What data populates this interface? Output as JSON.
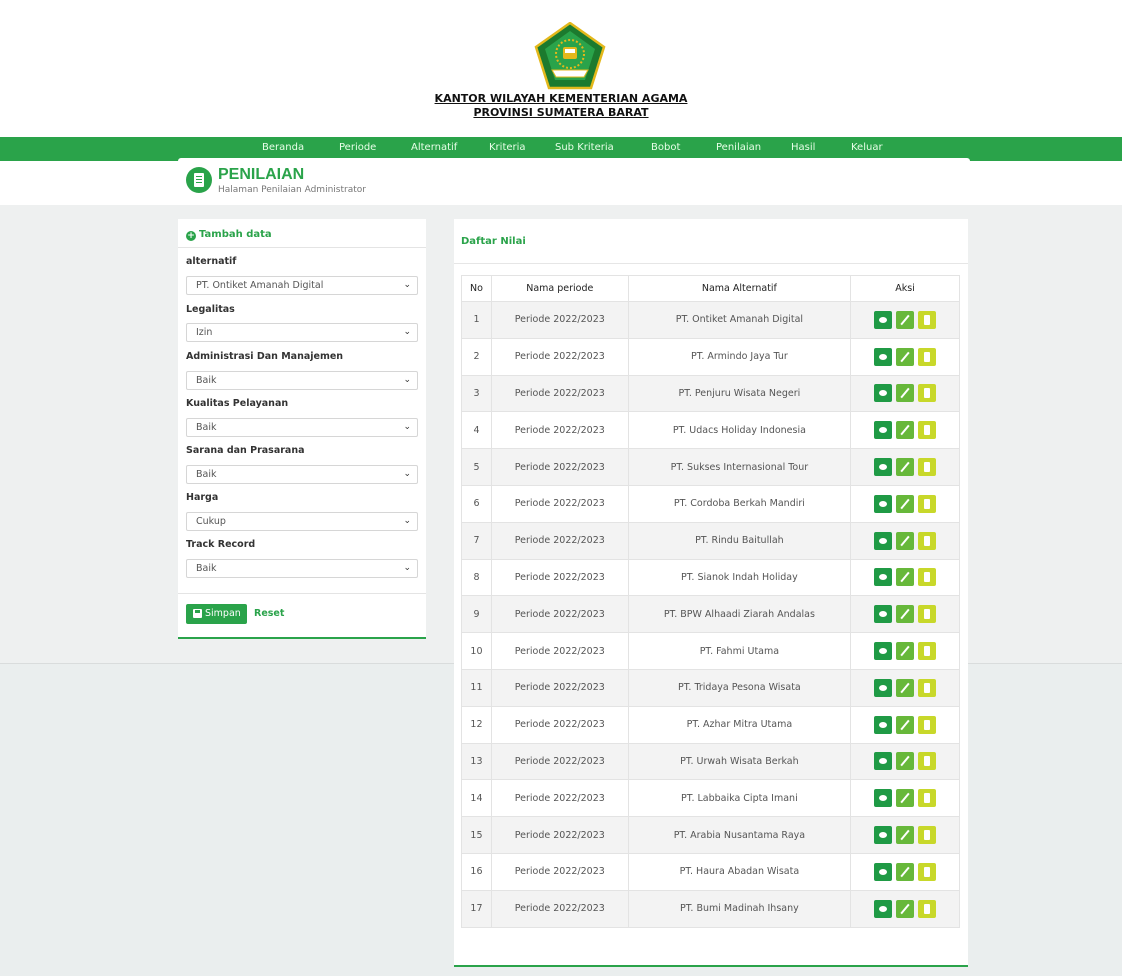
{
  "header": {
    "org_line1": "KANTOR WILAYAH KEMENTERIAN AGAMA",
    "org_line2": "PROVINSI SUMATERA BARAT"
  },
  "nav": {
    "items": [
      "Beranda",
      "Periode",
      "Alternatif",
      "Kriteria",
      "Sub Kriteria",
      "Bobot",
      "Penilaian",
      "Hasil",
      "Keluar"
    ]
  },
  "page": {
    "title": "PENILAIAN",
    "subtitle": "Halaman Penilaian Administrator"
  },
  "form": {
    "add_label": "Tambah data",
    "fields": [
      {
        "label": "alternatif",
        "value": "PT. Ontiket Amanah Digital"
      },
      {
        "label": "Legalitas",
        "value": "Izin"
      },
      {
        "label": "Administrasi Dan Manajemen",
        "value": "Baik"
      },
      {
        "label": "Kualitas Pelayanan",
        "value": "Baik"
      },
      {
        "label": "Sarana dan Prasarana",
        "value": "Baik"
      },
      {
        "label": "Harga",
        "value": "Cukup"
      },
      {
        "label": "Track Record",
        "value": "Baik"
      }
    ],
    "save_label": "Simpan",
    "reset_label": "Reset"
  },
  "table": {
    "title": "Daftar Nilai",
    "columns": [
      "No",
      "Nama periode",
      "Nama Alternatif",
      "Aksi"
    ],
    "rows": [
      {
        "no": "1",
        "periode": "Periode 2022/2023",
        "alternatif": "PT. Ontiket Amanah Digital"
      },
      {
        "no": "2",
        "periode": "Periode 2022/2023",
        "alternatif": "PT. Armindo Jaya Tur"
      },
      {
        "no": "3",
        "periode": "Periode 2022/2023",
        "alternatif": "PT. Penjuru Wisata Negeri"
      },
      {
        "no": "4",
        "periode": "Periode 2022/2023",
        "alternatif": "PT. Udacs Holiday Indonesia"
      },
      {
        "no": "5",
        "periode": "Periode 2022/2023",
        "alternatif": "PT. Sukses Internasional Tour"
      },
      {
        "no": "6",
        "periode": "Periode 2022/2023",
        "alternatif": "PT. Cordoba Berkah Mandiri"
      },
      {
        "no": "7",
        "periode": "Periode 2022/2023",
        "alternatif": "PT. Rindu Baitullah"
      },
      {
        "no": "8",
        "periode": "Periode 2022/2023",
        "alternatif": "PT. Sianok Indah Holiday"
      },
      {
        "no": "9",
        "periode": "Periode 2022/2023",
        "alternatif": "PT. BPW Alhaadi Ziarah Andalas"
      },
      {
        "no": "10",
        "periode": "Periode 2022/2023",
        "alternatif": "PT. Fahmi Utama"
      },
      {
        "no": "11",
        "periode": "Periode 2022/2023",
        "alternatif": "PT. Tridaya Pesona Wisata"
      },
      {
        "no": "12",
        "periode": "Periode 2022/2023",
        "alternatif": "PT. Azhar Mitra Utama"
      },
      {
        "no": "13",
        "periode": "Periode 2022/2023",
        "alternatif": "PT. Urwah Wisata Berkah"
      },
      {
        "no": "14",
        "periode": "Periode 2022/2023",
        "alternatif": "PT. Labbaika Cipta Imani"
      },
      {
        "no": "15",
        "periode": "Periode 2022/2023",
        "alternatif": "PT. Arabia Nusantama Raya"
      },
      {
        "no": "16",
        "periode": "Periode 2022/2023",
        "alternatif": "PT. Haura Abadan Wisata"
      },
      {
        "no": "17",
        "periode": "Periode 2022/2023",
        "alternatif": "PT. Bumi Madinah Ihsany"
      }
    ],
    "action_icons": [
      "eye-icon",
      "pencil-icon",
      "trash-icon"
    ]
  },
  "colors": {
    "brand_green": "#2aa34a",
    "view_btn": "#1f9a45",
    "edit_btn": "#67b83a",
    "delete_btn": "#c8d82a"
  }
}
